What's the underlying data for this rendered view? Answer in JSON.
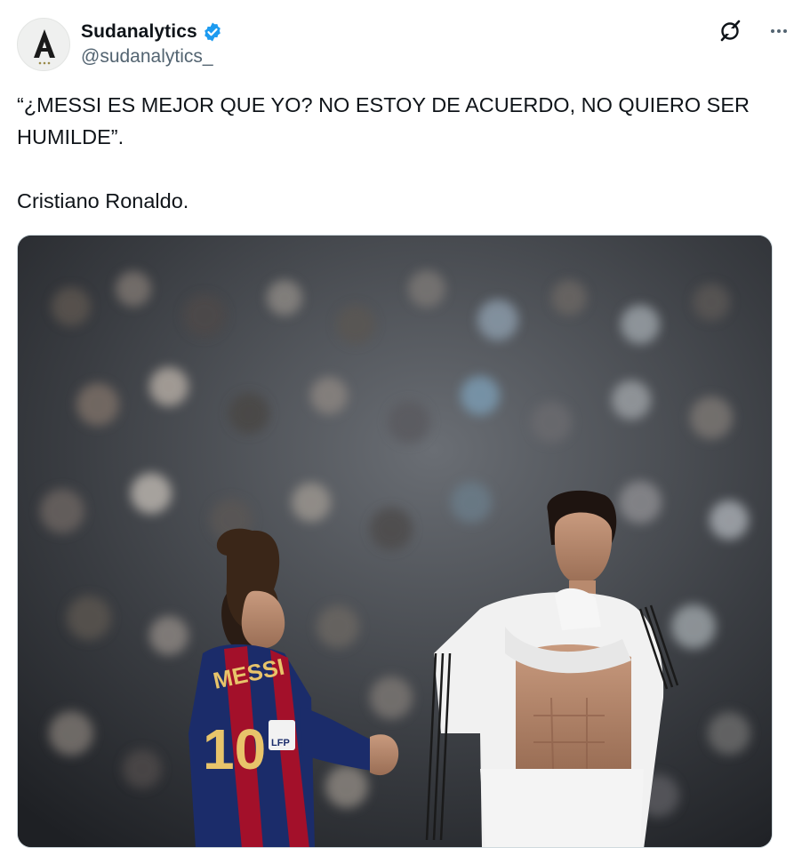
{
  "author": {
    "display_name": "Sudanalytics",
    "handle": "@sudanalytics_",
    "verified": true,
    "avatar_icon": "sudanalytics-logo-icon",
    "verified_color": "#1d9bf0"
  },
  "actions": {
    "grok_icon": "grok-icon",
    "more_icon": "more-dots-icon"
  },
  "tweet": {
    "line1": "“¿MESSI ES MEJOR QUE YO? NO ESTOY DE ACUERDO, NO QUIERO SER HUMILDE”.",
    "line2": "Cristiano Ronaldo."
  },
  "media": {
    "shirt_name": "MESSI",
    "shirt_number": "10",
    "badge": "LFP"
  },
  "colors": {
    "text_primary": "#0f1419",
    "text_secondary": "#536471"
  }
}
